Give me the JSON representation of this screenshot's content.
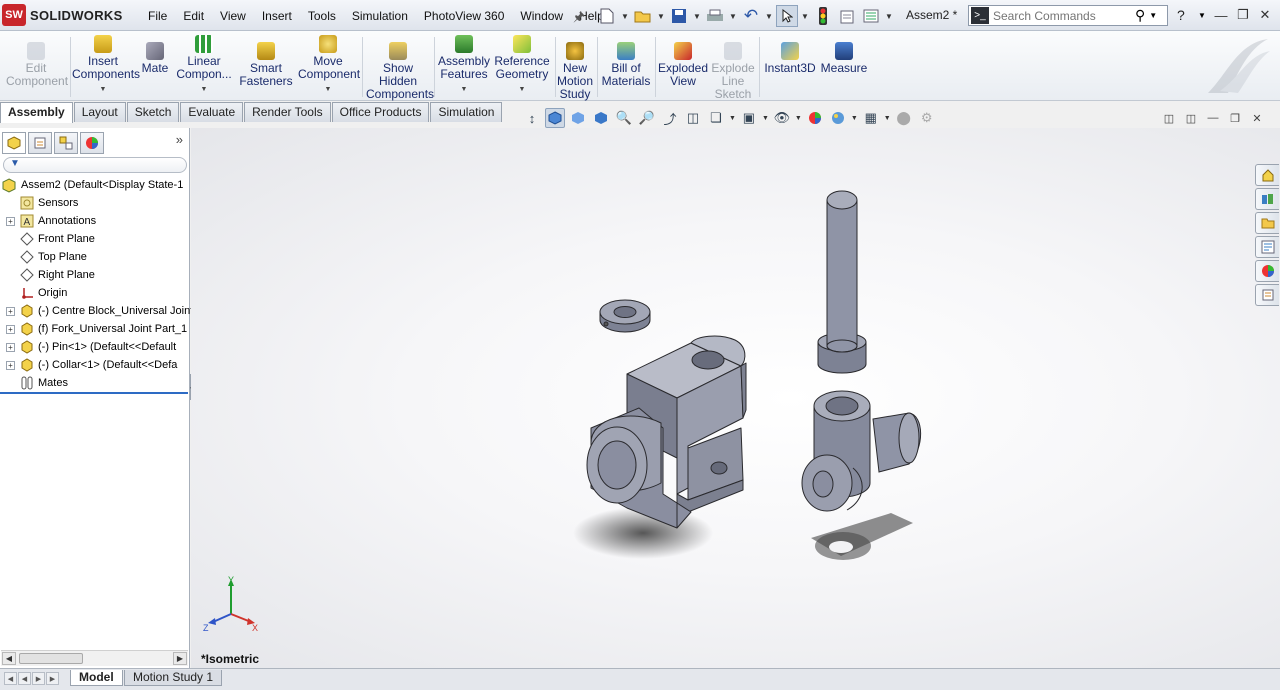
{
  "app": {
    "name": "SOLIDWORKS",
    "logo_mark": "SW",
    "document_title": "Assem2 *"
  },
  "menu": [
    "File",
    "Edit",
    "View",
    "Insert",
    "Tools",
    "Simulation",
    "PhotoView 360",
    "Window",
    "Help"
  ],
  "quick_access": [
    "new-document-icon",
    "open-icon",
    "save-icon",
    "print-icon",
    "undo-icon",
    "select-icon",
    "rebuild-icon",
    "file-properties-icon",
    "options-icon"
  ],
  "search": {
    "placeholder": "Search Commands"
  },
  "help_icon": "?",
  "command_manager": [
    {
      "label_lines": [
        "Edit",
        "Component"
      ],
      "enabled": false,
      "icon": "edit-component-icon"
    },
    {
      "label_lines": [
        "Insert",
        "Components"
      ],
      "enabled": true,
      "icon": "insert-components-icon",
      "dropdown": true
    },
    {
      "label_lines": [
        "Mate"
      ],
      "enabled": true,
      "icon": "mate-icon"
    },
    {
      "label_lines": [
        "Linear",
        "Compon..."
      ],
      "enabled": true,
      "icon": "linear-pattern-icon",
      "dropdown": true
    },
    {
      "label_lines": [
        "Smart",
        "Fasteners"
      ],
      "enabled": true,
      "icon": "smart-fasteners-icon"
    },
    {
      "label_lines": [
        "Move",
        "Component"
      ],
      "enabled": true,
      "icon": "move-component-icon",
      "dropdown": true
    },
    {
      "label_lines": [
        "Show",
        "Hidden",
        "Components"
      ],
      "enabled": true,
      "icon": "show-hidden-icon"
    },
    {
      "label_lines": [
        "Assembly",
        "Features"
      ],
      "enabled": true,
      "icon": "assembly-features-icon",
      "dropdown": true
    },
    {
      "label_lines": [
        "Reference",
        "Geometry"
      ],
      "enabled": true,
      "icon": "reference-geometry-icon",
      "dropdown": true
    },
    {
      "label_lines": [
        "New",
        "Motion",
        "Study"
      ],
      "enabled": true,
      "icon": "motion-study-icon"
    },
    {
      "label_lines": [
        "Bill of",
        "Materials"
      ],
      "enabled": true,
      "icon": "bom-icon"
    },
    {
      "label_lines": [
        "Exploded",
        "View"
      ],
      "enabled": true,
      "icon": "exploded-view-icon"
    },
    {
      "label_lines": [
        "Explode",
        "Line",
        "Sketch"
      ],
      "enabled": false,
      "icon": "explode-line-icon"
    },
    {
      "label_lines": [
        "Instant3D"
      ],
      "enabled": true,
      "icon": "instant3d-icon"
    },
    {
      "label_lines": [
        "Measure"
      ],
      "enabled": true,
      "icon": "measure-icon"
    }
  ],
  "tabs": [
    "Assembly",
    "Layout",
    "Sketch",
    "Evaluate",
    "Render Tools",
    "Office Products",
    "Simulation"
  ],
  "active_tab": "Assembly",
  "feature_tree": {
    "root": "Assem2  (Default<Display State-1",
    "items": [
      {
        "label": "Sensors",
        "icon": "sensor-icon",
        "expandable": false
      },
      {
        "label": "Annotations",
        "icon": "annotations-icon",
        "expandable": true
      },
      {
        "label": "Front Plane",
        "icon": "plane-icon",
        "expandable": false
      },
      {
        "label": "Top Plane",
        "icon": "plane-icon",
        "expandable": false
      },
      {
        "label": "Right Plane",
        "icon": "plane-icon",
        "expandable": false
      },
      {
        "label": "Origin",
        "icon": "origin-icon",
        "expandable": false
      },
      {
        "label": "(-) Centre Block_Universal Joint",
        "icon": "part-icon",
        "expandable": true
      },
      {
        "label": "(f) Fork_Universal Joint Part_1",
        "icon": "part-icon",
        "expandable": true
      },
      {
        "label": "(-) Pin<1> (Default<<Default",
        "icon": "part-icon",
        "expandable": true
      },
      {
        "label": "(-) Collar<1> (Default<<Defa",
        "icon": "part-icon",
        "expandable": true
      },
      {
        "label": "Mates",
        "icon": "mates-icon",
        "expandable": false
      }
    ]
  },
  "viewport": {
    "view_name": "*Isometric",
    "triad": {
      "x": "X",
      "y": "Y",
      "z": "Z"
    }
  },
  "bottom_tabs": [
    "Model",
    "Motion Study 1"
  ],
  "active_bottom_tab": "Model",
  "colors": {
    "part": "#8e93a6",
    "accent": "#2d6bc4",
    "brand_red": "#c8262b"
  }
}
